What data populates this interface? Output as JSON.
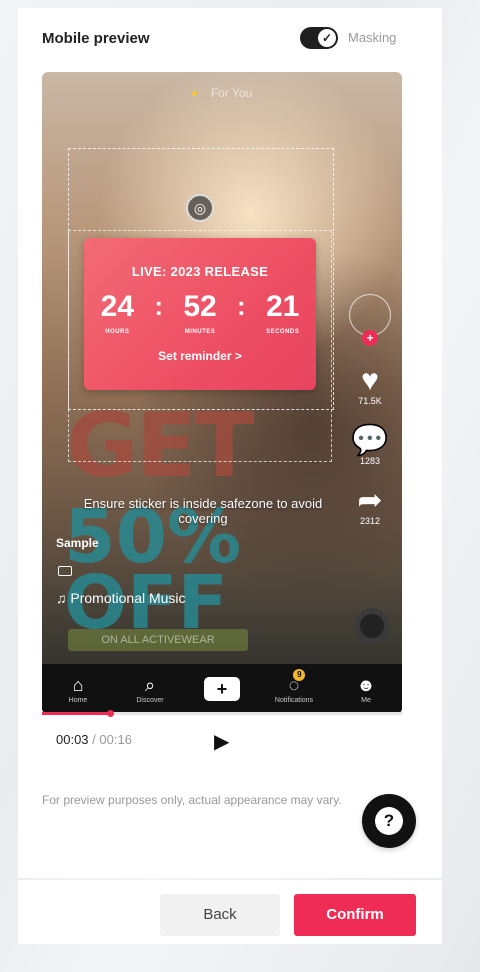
{
  "header": {
    "title": "Mobile preview",
    "toggle_label": "Masking",
    "toggle_on": true
  },
  "phone": {
    "top_text": "For You",
    "sticker": {
      "title": "LIVE: 2023 RELEASE",
      "hours": "24",
      "hours_label": "HOURS",
      "minutes": "52",
      "minutes_label": "MINUTES",
      "seconds": "21",
      "seconds_label": "SECONDS",
      "reminder": "Set reminder >"
    },
    "overlay_text": {
      "get": "GET",
      "off": "50% OFF"
    },
    "warning": "Ensure sticker is inside safezone to avoid covering",
    "username": "Sample",
    "music": "♫ Promotional Music",
    "cta": "ON ALL ACTIVEWEAR",
    "actions": {
      "likes": "71.5K",
      "comments": "1283",
      "shares": "2312"
    },
    "nav": [
      {
        "icon": "home-icon",
        "label": "Home"
      },
      {
        "icon": "discover-icon",
        "label": "Discover"
      },
      {
        "icon": "plus-icon",
        "label": ""
      },
      {
        "icon": "notifications-icon",
        "label": "Notifications",
        "badge": "9"
      },
      {
        "icon": "me-icon",
        "label": "Me"
      }
    ]
  },
  "player": {
    "current": "00:03",
    "duration": "/ 00:16",
    "progress_fraction": 0.19
  },
  "disclaimer": "For preview purposes only, actual appearance may vary.",
  "buttons": {
    "back": "Back",
    "confirm": "Confirm"
  },
  "colors": {
    "accent": "#ee2c55",
    "sticker": "#ee4f64"
  }
}
